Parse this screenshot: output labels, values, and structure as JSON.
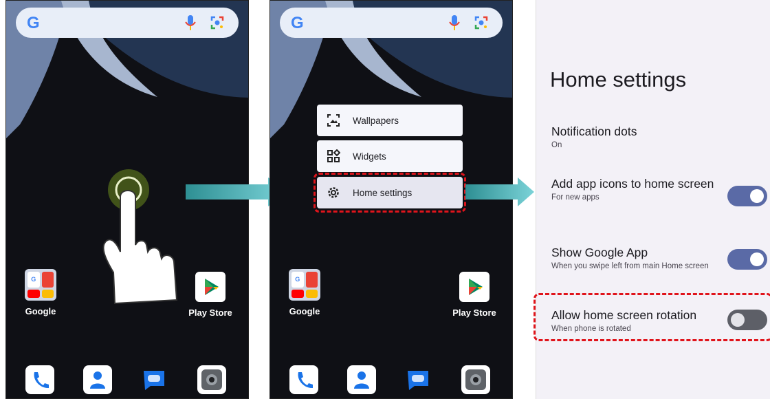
{
  "screen1": {
    "apps": [
      {
        "label": "Google"
      },
      {
        "label": "Play Store"
      }
    ]
  },
  "screen2": {
    "menu": [
      {
        "label": "Wallpapers",
        "icon": "wallpaper-icon"
      },
      {
        "label": "Widgets",
        "icon": "widgets-icon"
      },
      {
        "label": "Home settings",
        "icon": "gear-icon"
      }
    ],
    "apps": [
      {
        "label": "Google"
      },
      {
        "label": "Play Store"
      }
    ]
  },
  "settings": {
    "title": "Home settings",
    "items": [
      {
        "title": "Notification dots",
        "subtitle": "On"
      },
      {
        "title": "Add app icons to home screen",
        "subtitle": "For new apps",
        "toggle": "on"
      },
      {
        "title": "Show Google App",
        "subtitle": "When you swipe left from main Home screen",
        "toggle": "on"
      },
      {
        "title": "Allow home screen rotation",
        "subtitle": "When phone is rotated",
        "toggle": "off"
      }
    ]
  },
  "colors": {
    "highlight": "#e0141b",
    "arrow": "#2e8f93",
    "toggle_on": "#5a6aa6",
    "toggle_off": "#5d5f67"
  }
}
